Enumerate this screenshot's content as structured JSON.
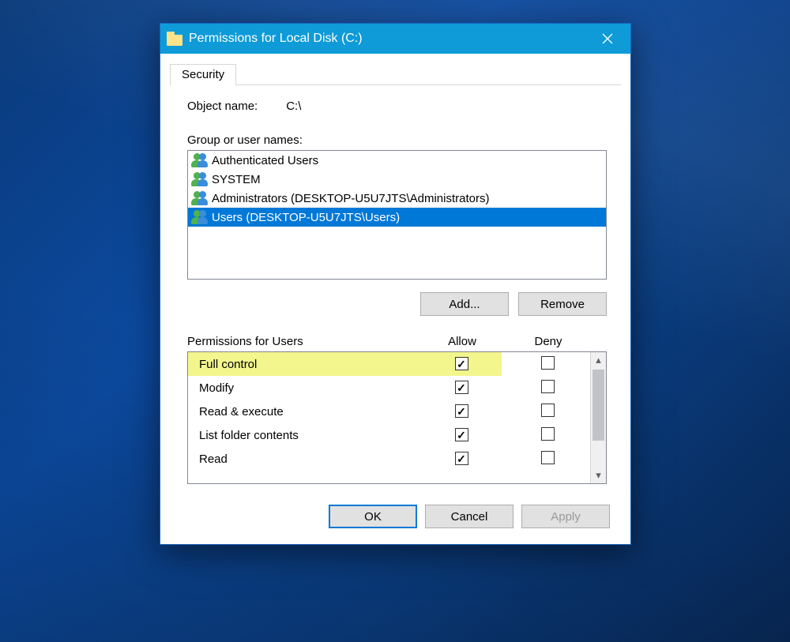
{
  "window": {
    "title": "Permissions for Local Disk (C:)"
  },
  "tab": {
    "security_label": "Security"
  },
  "object": {
    "label": "Object name:",
    "value": "C:\\"
  },
  "groups": {
    "label": "Group or user names:",
    "items": [
      {
        "name": "Authenticated Users"
      },
      {
        "name": "SYSTEM"
      },
      {
        "name": "Administrators (DESKTOP-U5U7JTS\\Administrators)"
      },
      {
        "name": "Users (DESKTOP-U5U7JTS\\Users)"
      }
    ],
    "selected_index": 3
  },
  "buttons": {
    "add": "Add...",
    "remove": "Remove",
    "ok": "OK",
    "cancel": "Cancel",
    "apply": "Apply"
  },
  "permissions": {
    "header_for": "Permissions for Users",
    "header_allow": "Allow",
    "header_deny": "Deny",
    "rows": [
      {
        "name": "Full control",
        "allow": true,
        "deny": false,
        "highlight": true
      },
      {
        "name": "Modify",
        "allow": true,
        "deny": false,
        "highlight": false
      },
      {
        "name": "Read & execute",
        "allow": true,
        "deny": false,
        "highlight": false
      },
      {
        "name": "List folder contents",
        "allow": true,
        "deny": false,
        "highlight": false
      },
      {
        "name": "Read",
        "allow": true,
        "deny": false,
        "highlight": false
      }
    ]
  }
}
